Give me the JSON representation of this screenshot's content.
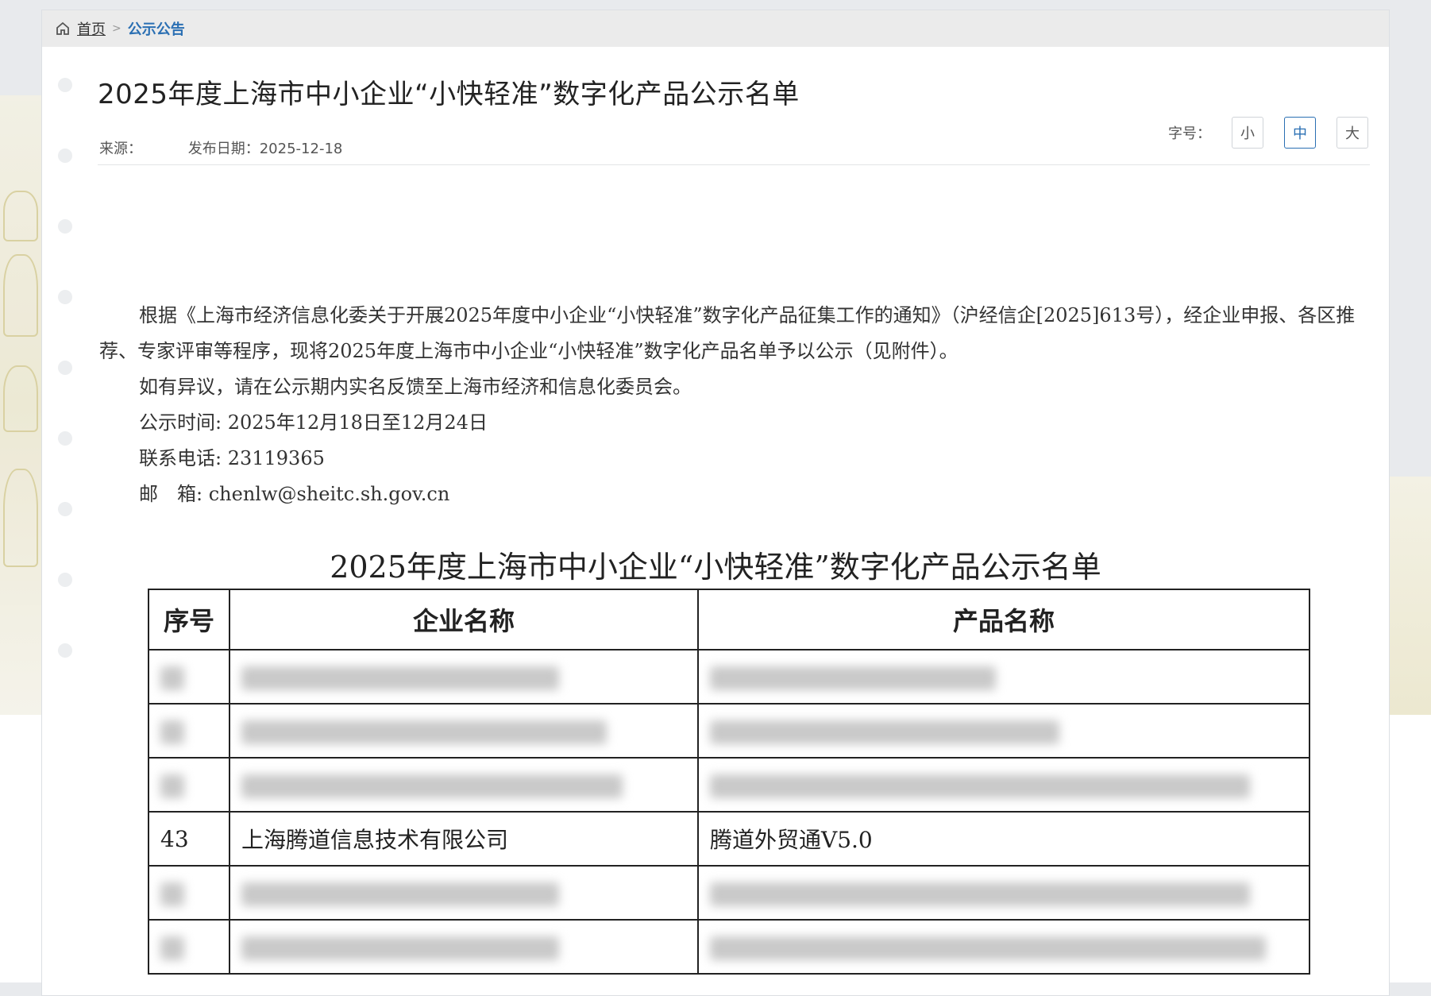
{
  "breadcrumb": {
    "home": "首页",
    "separator": ">",
    "current": "公示公告"
  },
  "article": {
    "title": "2025年度上海市中小企业“小快轻准”数字化产品公示名单",
    "source_label": "来源：",
    "date_label": "发布日期：",
    "date": "2025-12-18"
  },
  "font_size": {
    "label": "字号：",
    "small": "小",
    "medium": "中",
    "large": "大",
    "selected": "中"
  },
  "body": {
    "para1": "根据《上海市经济信息化委关于开展2025年度中小企业“小快轻准”数字化产品征集工作的通知》（沪经信企[2025]613号），经企业申报、各区推荐、专家评审等程序，现将2025年度上海市中小企业“小快轻准”数字化产品名单予以公示（见附件）。",
    "para2": "如有异议，请在公示期内实名反馈至上海市经济和信息化委员会。",
    "period": "公示时间: 2025年12月18日至12月24日",
    "phone": "联系电话: 23119365",
    "email": "邮　箱: chenlw@sheitc.sh.gov.cn"
  },
  "table": {
    "title": "2025年度上海市中小企业“小快轻准”数字化产品公示名单",
    "headers": [
      "序号",
      "企业名称",
      "产品名称"
    ],
    "visible_row": {
      "no": "43",
      "company": "上海腾道信息技术有限公司",
      "product": "腾道外贸通V5.0"
    }
  }
}
